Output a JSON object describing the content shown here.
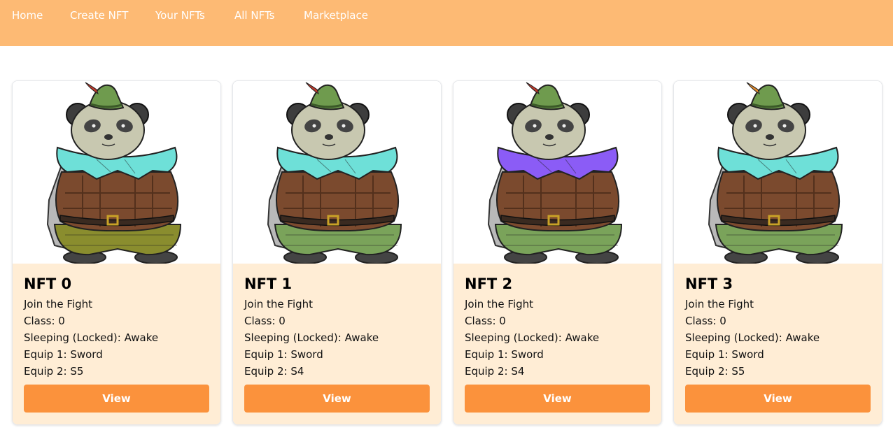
{
  "nav": {
    "items": [
      {
        "label": "Home"
      },
      {
        "label": "Create NFT"
      },
      {
        "label": "Your NFTs"
      },
      {
        "label": "All NFTs"
      },
      {
        "label": "Marketplace"
      }
    ]
  },
  "cards": [
    {
      "title": "NFT 0",
      "subtitle": "Join the Fight",
      "class_line": "Class: 0",
      "sleeping_line": "Sleeping (Locked): Awake",
      "equip1_line": "Equip 1: Sword",
      "equip2_line": "Equip 2: S5",
      "button_label": "View",
      "colors": {
        "scarf": "#6ee0d8",
        "pants": "#8a8d2e",
        "hat_accent": "#c0392b"
      }
    },
    {
      "title": "NFT 1",
      "subtitle": "Join the Fight",
      "class_line": "Class: 0",
      "sleeping_line": "Sleeping (Locked): Awake",
      "equip1_line": "Equip 1: Sword",
      "equip2_line": "Equip 2: S4",
      "button_label": "View",
      "colors": {
        "scarf": "#6ee0d8",
        "pants": "#7aa35a",
        "hat_accent": "#c0392b"
      }
    },
    {
      "title": "NFT 2",
      "subtitle": "Join the Fight",
      "class_line": "Class: 0",
      "sleeping_line": "Sleeping (Locked): Awake",
      "equip1_line": "Equip 1: Sword",
      "equip2_line": "Equip 2: S4",
      "button_label": "View",
      "colors": {
        "scarf": "#8b5cf6",
        "pants": "#7aa35a",
        "hat_accent": "#c0392b"
      }
    },
    {
      "title": "NFT 3",
      "subtitle": "Join the Fight",
      "class_line": "Class: 0",
      "sleeping_line": "Sleeping (Locked): Awake",
      "equip1_line": "Equip 1: Sword",
      "equip2_line": "Equip 2: S5",
      "button_label": "View",
      "colors": {
        "scarf": "#6ee0d8",
        "pants": "#7aa35a",
        "hat_accent": "#e08a2e"
      }
    }
  ],
  "theme": {
    "navbar": "#fdba74",
    "card_body": "#ffedd5",
    "button": "#fb923c"
  }
}
